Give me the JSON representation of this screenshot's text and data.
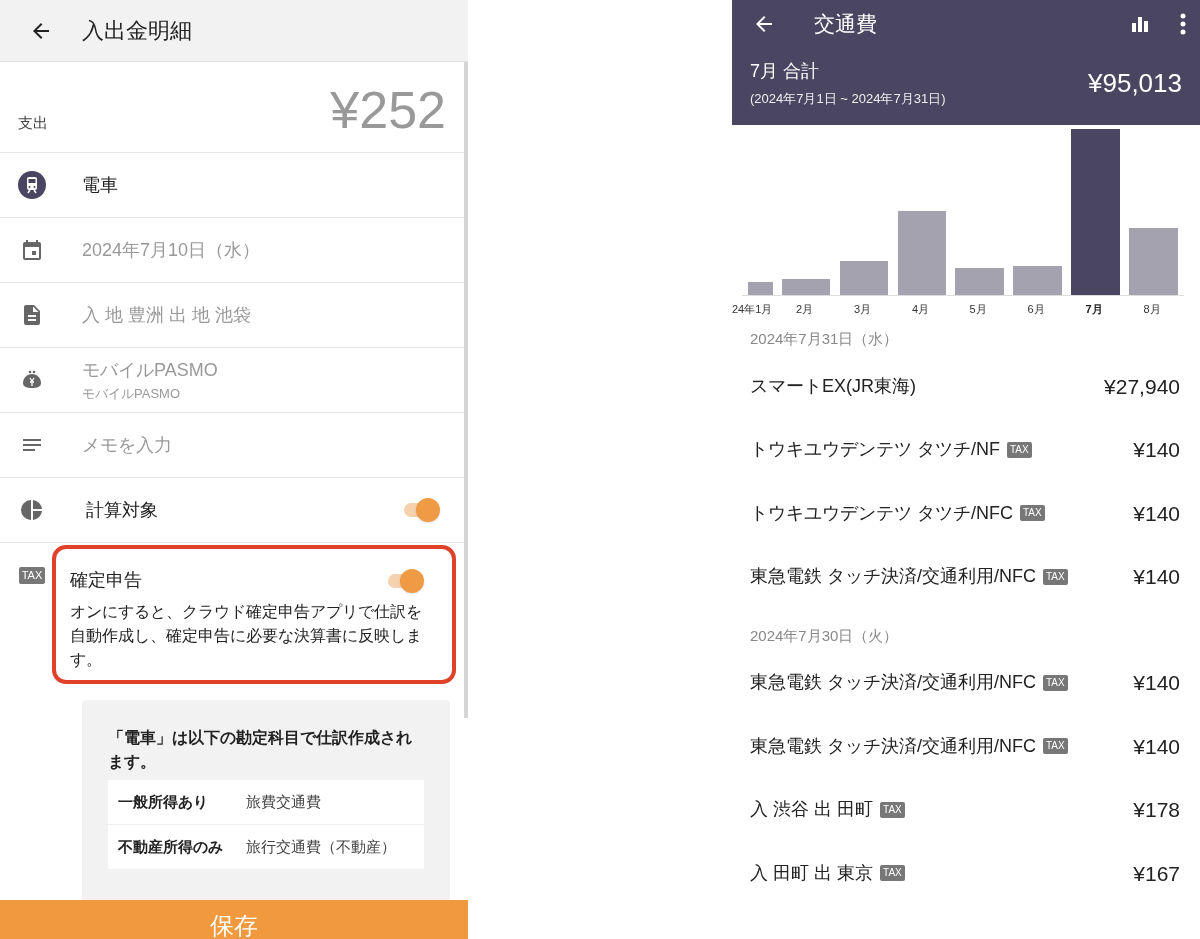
{
  "left_screen": {
    "app_bar": {
      "title": "入出金明細"
    },
    "amount": {
      "type_label": "支出",
      "value": "¥252"
    },
    "fields": [
      {
        "kind": "category",
        "text": "電車"
      },
      {
        "kind": "date",
        "text": "2024年7月10日（水）"
      },
      {
        "kind": "note",
        "text": "入 地 豊洲 出 地 池袋"
      },
      {
        "kind": "wallet",
        "text": "モバイルPASMO",
        "subtext": "モバイルPASMO"
      },
      {
        "kind": "memo",
        "placeholder": "メモを入力"
      }
    ],
    "toggles": [
      {
        "kind": "calc",
        "label": "計算対象",
        "on": true,
        "highlighted": false
      },
      {
        "kind": "tax",
        "badge": "TAX",
        "label": "確定申告",
        "on": true,
        "highlighted": true,
        "description": "オンにすると、クラウド確定申告アプリで仕訳を自動作成し、確定申告に必要な決算書に反映します。"
      }
    ],
    "account_card": {
      "intro": "「電車」は以下の勘定科目で仕訳作成されます。",
      "rows": [
        {
          "label": "一般所得あり",
          "value": "旅費交通費"
        },
        {
          "label": "不動産所得のみ",
          "value": "旅行交通費（不動産）"
        }
      ]
    },
    "save_button": "保存"
  },
  "right_screen": {
    "app_bar": {
      "title": "交通費"
    },
    "summary": {
      "period_label": "7月 合計",
      "range": "(2024年7月1日 ~ 2024年7月31日)",
      "total": "¥95,013"
    },
    "chart_months": [
      {
        "label": "24年1月",
        "selected": false
      },
      {
        "label": "2月",
        "selected": false
      },
      {
        "label": "3月",
        "selected": false
      },
      {
        "label": "4月",
        "selected": false
      },
      {
        "label": "5月",
        "selected": false
      },
      {
        "label": "6月",
        "selected": false
      },
      {
        "label": "7月",
        "selected": true
      },
      {
        "label": "8月",
        "selected": false
      }
    ],
    "days": [
      {
        "date": "2024年7月31日（水）",
        "entries": [
          {
            "name": "スマートEX(JR東海)",
            "amount": "¥27,940"
          },
          {
            "name": "トウキユウデンテツ タツチ/NF",
            "tax_badge": "TAX",
            "amount": "¥140"
          },
          {
            "name": "トウキユウデンテツ タツチ/NFC",
            "tax_badge": "TAX",
            "amount": "¥140"
          },
          {
            "name": "東急電鉄 タッチ決済/交通利用/NFC",
            "tax_badge": "TAX",
            "amount": "¥140"
          }
        ]
      },
      {
        "date": "2024年7月30日（火）",
        "entries": [
          {
            "name": "東急電鉄 タッチ決済/交通利用/NFC",
            "tax_badge": "TAX",
            "amount": "¥140"
          },
          {
            "name": "東急電鉄 タッチ決済/交通利用/NFC",
            "tax_badge": "TAX",
            "amount": "¥140"
          },
          {
            "name": "入 渋谷 出 田町",
            "tax_badge": "TAX",
            "amount": "¥178"
          },
          {
            "name": "入 田町 出 東京",
            "tax_badge": "TAX",
            "amount": "¥167"
          }
        ]
      }
    ]
  }
}
